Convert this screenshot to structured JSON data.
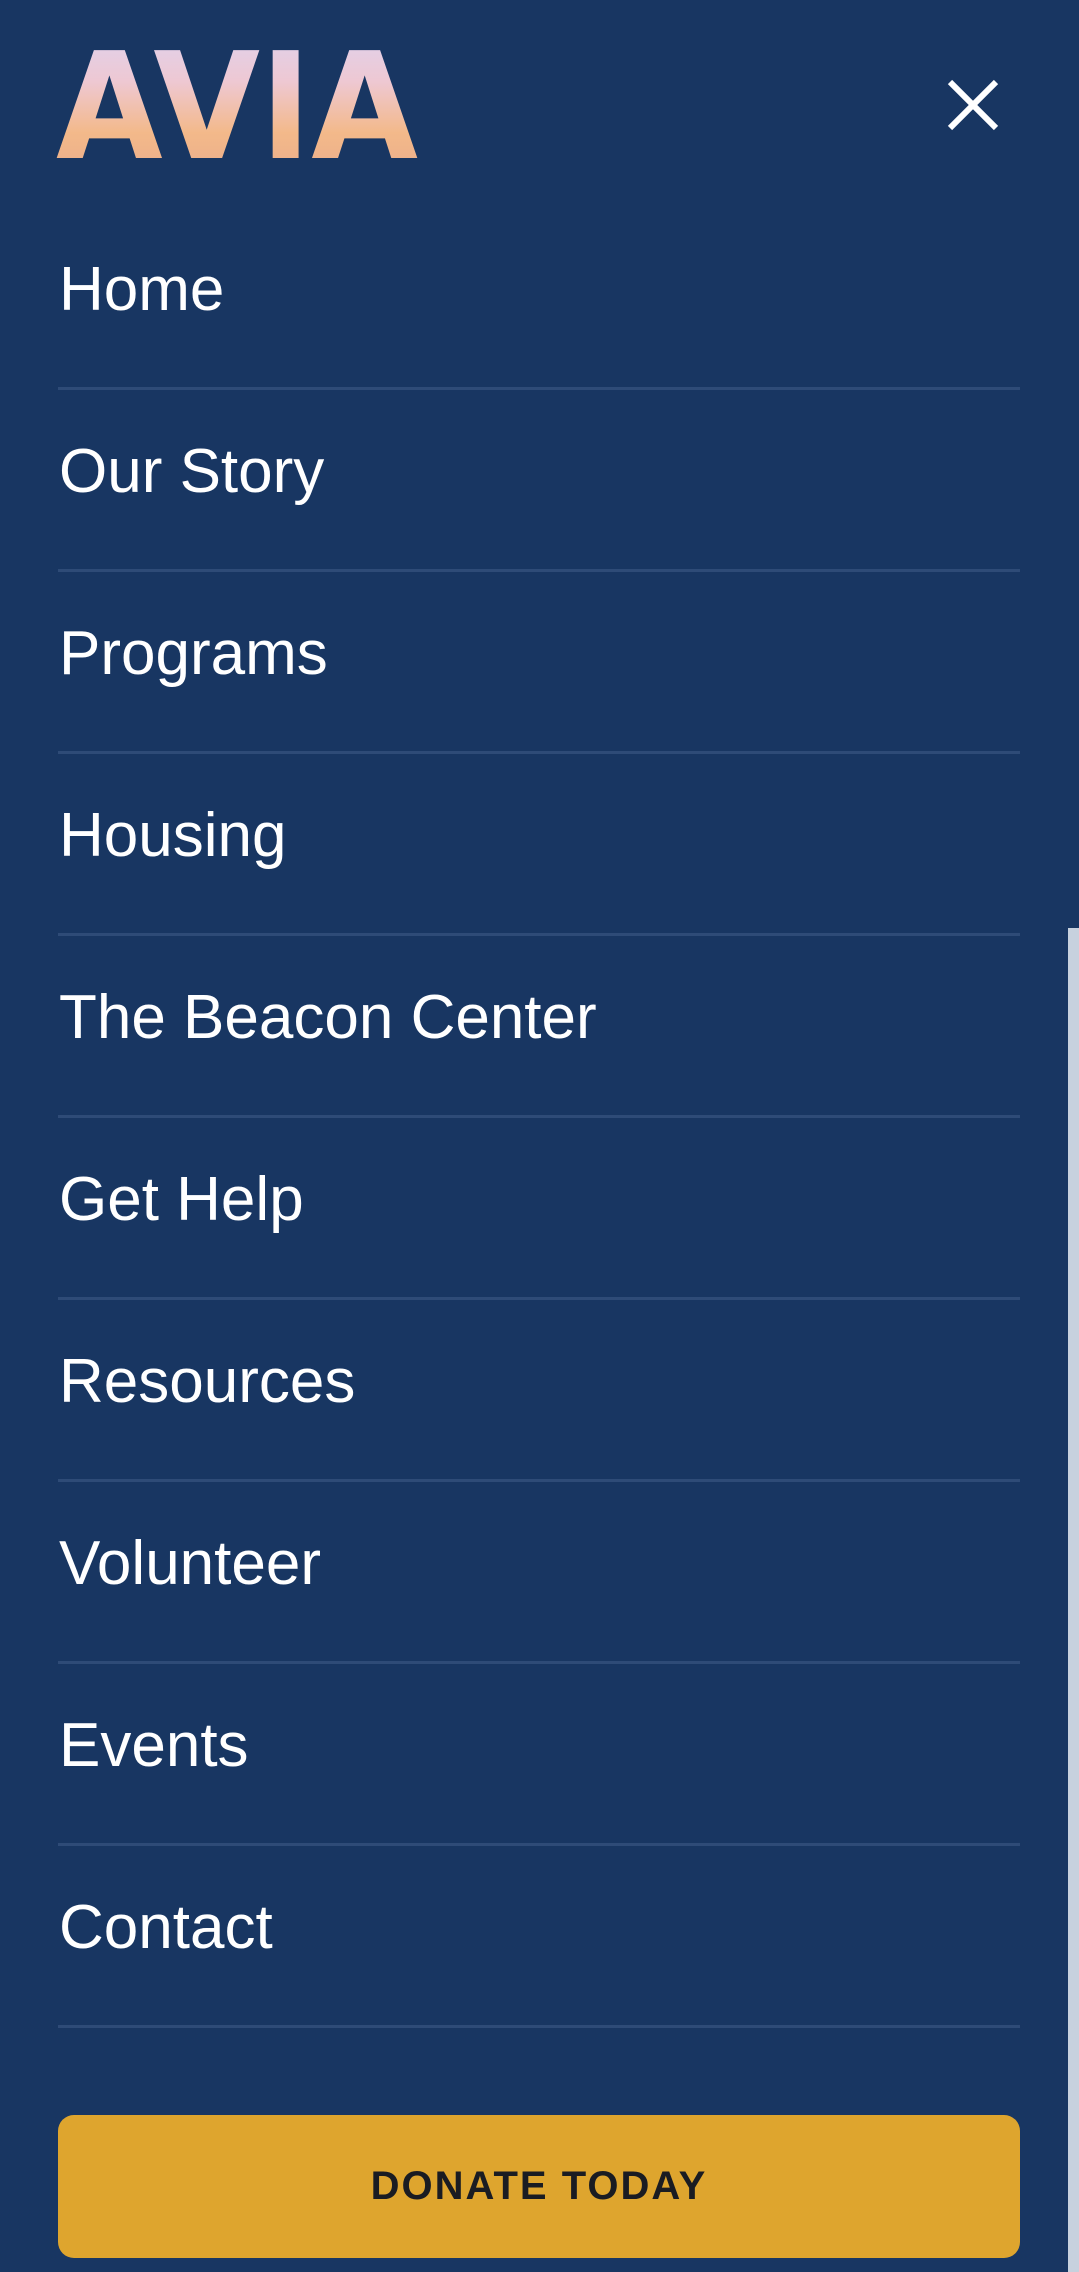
{
  "logo": {
    "text": "AVIA"
  },
  "header": {
    "close_icon": "close-icon"
  },
  "nav": {
    "items": [
      {
        "label": "Home"
      },
      {
        "label": "Our Story"
      },
      {
        "label": "Programs"
      },
      {
        "label": "Housing"
      },
      {
        "label": "The Beacon Center"
      },
      {
        "label": "Get Help"
      },
      {
        "label": "Resources"
      },
      {
        "label": "Volunteer"
      },
      {
        "label": "Events"
      },
      {
        "label": "Contact"
      }
    ]
  },
  "donate": {
    "label": "DONATE TODAY"
  },
  "colors": {
    "background": "#183662",
    "divider": "#2e4b77",
    "donate_button": "#dea52e",
    "donate_text": "#1a1c22",
    "text": "#ffffff"
  }
}
